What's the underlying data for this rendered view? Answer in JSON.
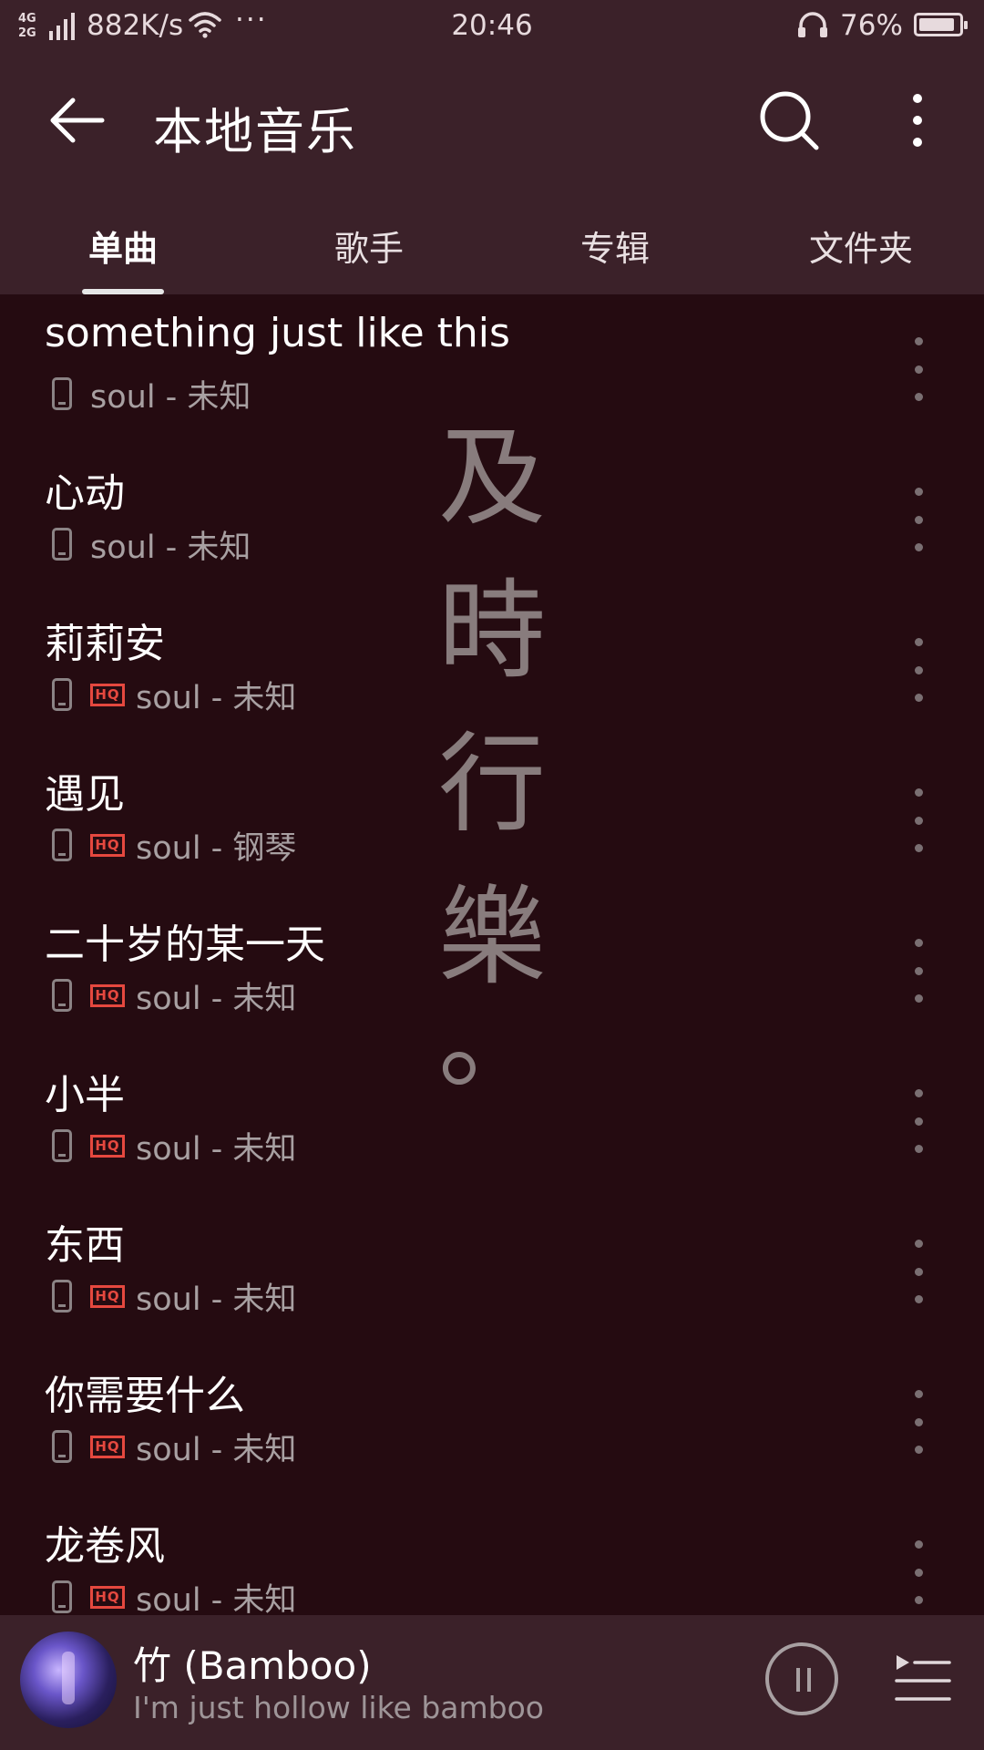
{
  "status_bar": {
    "network": "4G",
    "network2": "2G",
    "speed": "882K/s",
    "more": "···",
    "time": "20:46",
    "battery": "76%"
  },
  "header": {
    "title": "本地音乐",
    "icons": [
      "back-arrow-icon",
      "search-icon",
      "more-vertical-icon"
    ]
  },
  "tabs": [
    {
      "label": "单曲",
      "active": true
    },
    {
      "label": "歌手",
      "active": false
    },
    {
      "label": "专辑",
      "active": false
    },
    {
      "label": "文件夹",
      "active": false
    }
  ],
  "watermark": {
    "line1": "及",
    "line2": "時",
    "line3": "行",
    "line4": "樂",
    "line5": "。"
  },
  "songs": [
    {
      "title": "something just like this",
      "subtitle": "soul - 未知",
      "hq": false
    },
    {
      "title": "心动",
      "subtitle": "soul - 未知",
      "hq": false
    },
    {
      "title": "莉莉安",
      "subtitle": "soul - 未知",
      "hq": true
    },
    {
      "title": "遇见",
      "subtitle": "soul - 钢琴",
      "hq": true
    },
    {
      "title": "二十岁的某一天",
      "subtitle": "soul - 未知",
      "hq": true
    },
    {
      "title": "小半",
      "subtitle": "soul - 未知",
      "hq": true
    },
    {
      "title": "东西",
      "subtitle": "soul - 未知",
      "hq": true
    },
    {
      "title": "你需要什么",
      "subtitle": "soul - 未知",
      "hq": true
    },
    {
      "title": "龙卷风",
      "subtitle": "soul - 未知",
      "hq": true
    }
  ],
  "hq_label": "HQ",
  "now_playing": {
    "title": "竹 (Bamboo)",
    "subtitle": "I'm just hollow like bamboo"
  },
  "colors": {
    "header_bg": "#3b2129",
    "list_bg": "#250b11",
    "hq_accent": "#e5483f",
    "text_primary": "#ffffff",
    "text_secondary": "#a8a0a2"
  }
}
